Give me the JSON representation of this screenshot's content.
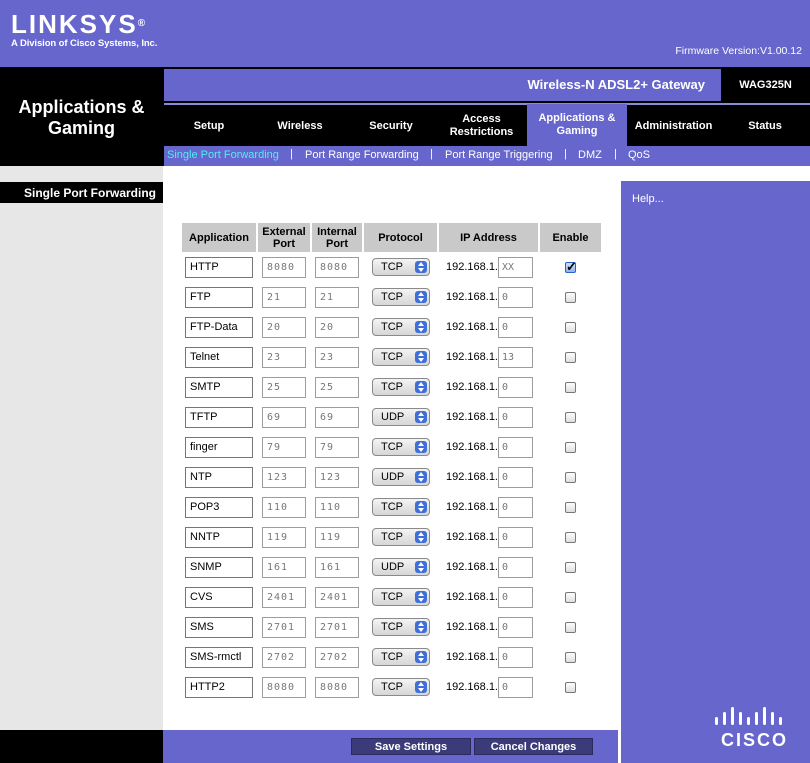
{
  "brand": {
    "logo": "LINKSYS",
    "logo_reg": "®",
    "tagline": "A Division of Cisco Systems, Inc.",
    "firmware": "Firmware Version:V1.00.12"
  },
  "header": {
    "section_title": "Applications & Gaming",
    "product_name": "Wireless-N ADSL2+ Gateway",
    "model": "WAG325N"
  },
  "main_tabs": [
    {
      "label": "Setup"
    },
    {
      "label": "Wireless"
    },
    {
      "label": "Security"
    },
    {
      "label": "Access Restrictions"
    },
    {
      "label": "Applications & Gaming",
      "active": true
    },
    {
      "label": "Administration"
    },
    {
      "label": "Status"
    }
  ],
  "sub_tabs": [
    {
      "label": "Single Port Forwarding",
      "active": true
    },
    {
      "label": "Port Range Forwarding"
    },
    {
      "label": "Port Range Triggering"
    },
    {
      "label": "DMZ"
    },
    {
      "label": "QoS"
    }
  ],
  "sub_tab_separator": "|",
  "sidebar": {
    "title": "Single Port Forwarding"
  },
  "help": {
    "label": "Help..."
  },
  "table": {
    "headers": {
      "application": "Application",
      "external_port": "External Port",
      "internal_port": "Internal Port",
      "protocol": "Protocol",
      "ip_address": "IP Address",
      "enable": "Enable"
    },
    "ip_prefix": "192.168.1.",
    "rows": [
      {
        "app": "HTTP",
        "ext": "8080",
        "int": "8080",
        "proto": "TCP",
        "ip": "XX",
        "enabled": true
      },
      {
        "app": "FTP",
        "ext": "21",
        "int": "21",
        "proto": "TCP",
        "ip": "0",
        "enabled": false
      },
      {
        "app": "FTP-Data",
        "ext": "20",
        "int": "20",
        "proto": "TCP",
        "ip": "0",
        "enabled": false
      },
      {
        "app": "Telnet",
        "ext": "23",
        "int": "23",
        "proto": "TCP",
        "ip": "13",
        "enabled": false
      },
      {
        "app": "SMTP",
        "ext": "25",
        "int": "25",
        "proto": "TCP",
        "ip": "0",
        "enabled": false
      },
      {
        "app": "TFTP",
        "ext": "69",
        "int": "69",
        "proto": "UDP",
        "ip": "0",
        "enabled": false
      },
      {
        "app": "finger",
        "ext": "79",
        "int": "79",
        "proto": "TCP",
        "ip": "0",
        "enabled": false
      },
      {
        "app": "NTP",
        "ext": "123",
        "int": "123",
        "proto": "UDP",
        "ip": "0",
        "enabled": false
      },
      {
        "app": "POP3",
        "ext": "110",
        "int": "110",
        "proto": "TCP",
        "ip": "0",
        "enabled": false
      },
      {
        "app": "NNTP",
        "ext": "119",
        "int": "119",
        "proto": "TCP",
        "ip": "0",
        "enabled": false
      },
      {
        "app": "SNMP",
        "ext": "161",
        "int": "161",
        "proto": "UDP",
        "ip": "0",
        "enabled": false
      },
      {
        "app": "CVS",
        "ext": "2401",
        "int": "2401",
        "proto": "TCP",
        "ip": "0",
        "enabled": false
      },
      {
        "app": "SMS",
        "ext": "2701",
        "int": "2701",
        "proto": "TCP",
        "ip": "0",
        "enabled": false
      },
      {
        "app": "SMS-rmctl",
        "ext": "2702",
        "int": "2702",
        "proto": "TCP",
        "ip": "0",
        "enabled": false
      },
      {
        "app": "HTTP2",
        "ext": "8080",
        "int": "8080",
        "proto": "TCP",
        "ip": "0",
        "enabled": false
      }
    ]
  },
  "buttons": {
    "save": "Save Settings",
    "cancel": "Cancel Changes"
  },
  "cisco_logo": "CISCO",
  "colors": {
    "brand_purple": "#6666cc",
    "header_black": "#000000",
    "active_subtab": "#4ff0f0",
    "table_header": "#c9c9c9",
    "button": "#3b3b7a"
  }
}
